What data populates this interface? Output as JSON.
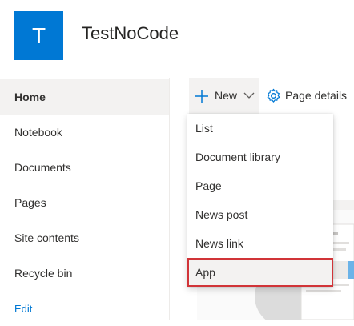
{
  "site": {
    "logo_letter": "T",
    "title": "TestNoCode",
    "accent_color": "#0078d4"
  },
  "nav": {
    "items": [
      {
        "label": "Home",
        "active": true
      },
      {
        "label": "Notebook"
      },
      {
        "label": "Documents"
      },
      {
        "label": "Pages"
      },
      {
        "label": "Site contents"
      },
      {
        "label": "Recycle bin"
      }
    ],
    "edit_label": "Edit"
  },
  "command_bar": {
    "new_label": "New",
    "new_icon": "plus-icon",
    "new_chevron": "chevron-down-icon",
    "page_details_label": "Page details",
    "page_details_icon": "gear-icon"
  },
  "new_menu": {
    "items": [
      "List",
      "Document library",
      "Page",
      "News post",
      "News link",
      "App"
    ],
    "highlighted": "App",
    "highlight_color": "#d13438"
  }
}
